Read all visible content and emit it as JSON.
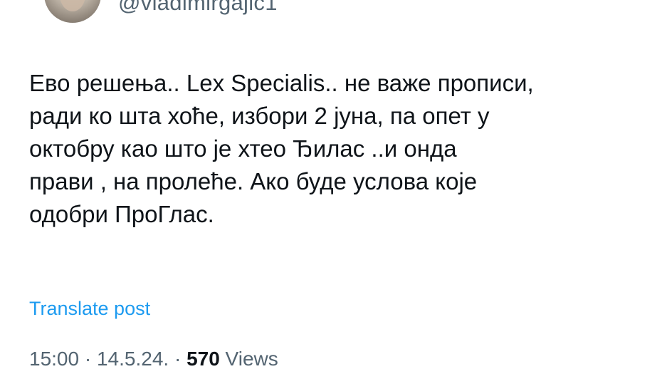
{
  "author": {
    "handle": "@vladimirgajic1"
  },
  "tweet": {
    "lines": [
      "Ево решења.. Lex Specialis.. не важе прописи,",
      "ради ко шта хоће, избори 2 јуна, па опет у",
      "октобру као што је хтео Ђилас ..и онда",
      "прави , на пролеће. Ако буде услова које",
      "одобри ПроГлас."
    ],
    "translate_label": "Translate post"
  },
  "meta": {
    "time": "15:00",
    "separator": " · ",
    "date": "14.5.24.",
    "views_count": "570",
    "views_label": " Views"
  }
}
